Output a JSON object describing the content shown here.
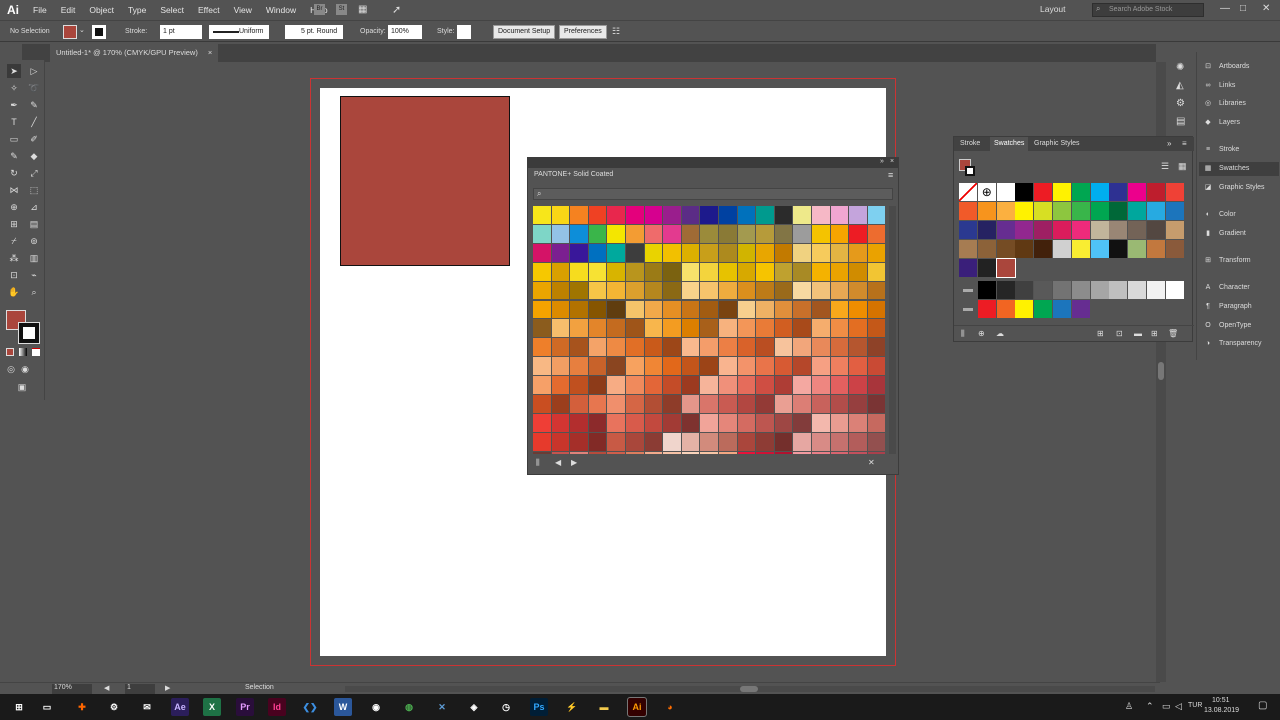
{
  "app": {
    "logo": "Ai",
    "layout": "Layout",
    "search_placeholder": "Search Adobe Stock"
  },
  "menu": [
    "File",
    "Edit",
    "Object",
    "Type",
    "Select",
    "Effect",
    "View",
    "Window",
    "Help"
  ],
  "control": {
    "selection": "No Selection",
    "stroke_label": "Stroke:",
    "stroke_weight": "1 pt",
    "profile": "Uniform",
    "brush": "5 pt. Round",
    "opacity_label": "Opacity:",
    "opacity": "100%",
    "style_label": "Style:",
    "doc_setup": "Document Setup",
    "preferences": "Preferences"
  },
  "document_tab": {
    "title": "Untitled-1* @ 170% (CMYK/GPU Preview)",
    "close": "×"
  },
  "pantone": {
    "title": "PANTONE+ Solid Coated",
    "search_icon": "search-icon"
  },
  "swatches_panel": {
    "tabs": [
      "Stroke",
      "Swatches",
      "Graphic Styles"
    ],
    "active": "Swatches"
  },
  "right_dock": {
    "group1": [
      "Artboards",
      "Links",
      "Libraries",
      "Layers"
    ],
    "group2": [
      "Stroke",
      "Swatches",
      "Graphic Styles"
    ],
    "group3": [
      "Color",
      "Gradient"
    ],
    "group4": [
      "Transform"
    ],
    "group5": [
      "Character",
      "Paragraph",
      "OpenType"
    ],
    "group6": [
      "Transparency"
    ]
  },
  "status": {
    "zoom": "170%",
    "page": "1",
    "tool": "Selection"
  },
  "taskbar": {
    "time": "10:51",
    "date": "13.08.2019",
    "lang": "TUR"
  },
  "colors": {
    "fill": "#aa463c",
    "accent": "#c33"
  }
}
